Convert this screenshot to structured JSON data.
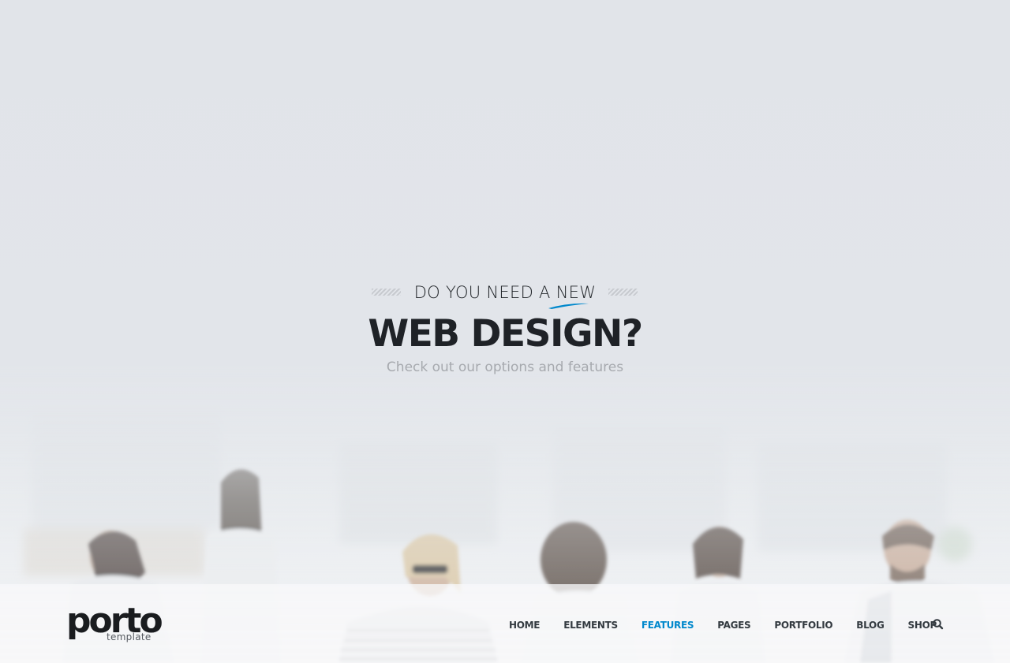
{
  "hero": {
    "pre_title": "DO YOU NEED A NEW",
    "title": "WEB DESIGN?",
    "subtitle": "Check out our options and features"
  },
  "logo": {
    "word": "porto",
    "sub": "template"
  },
  "nav": {
    "items": [
      {
        "label": "HOME"
      },
      {
        "label": "ELEMENTS"
      },
      {
        "label": "FEATURES"
      },
      {
        "label": "PAGES"
      },
      {
        "label": "PORTFOLIO"
      },
      {
        "label": "BLOG"
      },
      {
        "label": "SHOP"
      }
    ],
    "active_label": "FEATURES"
  },
  "icons": {
    "search": "search-icon"
  },
  "colors": {
    "accent": "#0088cc",
    "title": "#1f2227",
    "subtitle": "#a6a9ae"
  }
}
